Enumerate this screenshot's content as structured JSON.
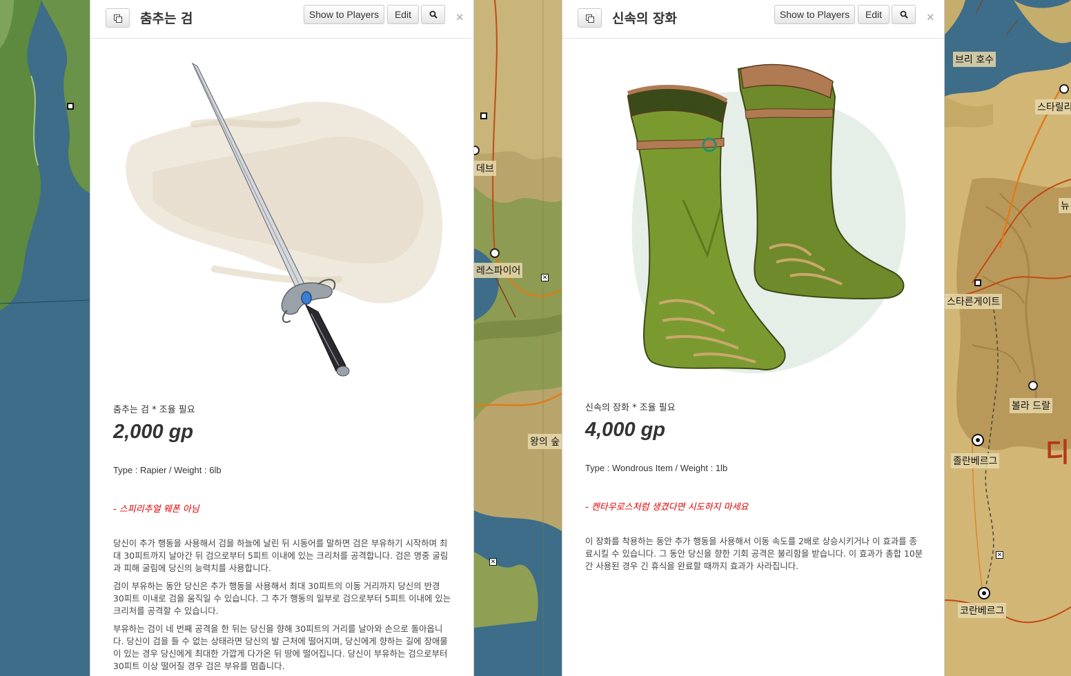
{
  "map": {
    "labels": {
      "dev": "데브",
      "lespire": "레스파이어",
      "king_forest": "왕의 숲",
      "bree_lake": "브리 호수",
      "starill": "스타릴리",
      "nyu": "뉴",
      "starngate": "스타른게이트",
      "bolla_dral": "볼라 드랄",
      "jolanberg": "졸란베르그",
      "koranberg": "코란베르그",
      "region": "디"
    }
  },
  "panels": [
    {
      "title": "춤추는 검",
      "buttons": {
        "show": "Show to Players",
        "edit": "Edit"
      },
      "subtitle": "춤추는 검 * 조율 필요",
      "price": "2,000 gp",
      "type_line": "Type : Rapier / Weight : 6lb",
      "note": "- 스피리추얼 웨폰 아님",
      "paragraphs": [
        "당신이 추가 행동을 사용해서 검을 하늘에 날린 뒤 시동어를 말하면 검은 부유하기 시작하며 최대 30피트까지 날아간 뒤 검으로부터 5피트 이내에 있는 크리처를 공격합니다. 검은 명중 굴림과 피해 굴림에 당신의 능력치를 사용합니다.",
        "검이 부유하는 동안 당신은 추가 행동을 사용해서 최대 30피트의 이동 거리까지 당신의 반경 30피트 이내로 검을 움직일 수 있습니다. 그 추가 행동의 일부로 검으로부터 5피트 이내에 있는 크리처를 공격할 수 있습니다.",
        "부유하는 검이 네 번째 공격을 한 뒤는 당신을 향해 30피트의 거리를 날아와 손으로 돌아옵니다. 당신이 검을 들 수 없는 상태라면 당신의 발 근처에 떨어지며, 당신에게 향하는 길에 장애물이 있는 경우 당신에게 최대한 가깝게 다가온 뒤 땅에 떨어집니다. 당신이 부유하는 검으로부터 30피트 이상 떨어질 경우 검은 부유를 멈춥니다."
      ]
    },
    {
      "title": "신속의 장화",
      "buttons": {
        "show": "Show to Players",
        "edit": "Edit"
      },
      "subtitle": "신속의 장화 * 조율 필요",
      "price": "4,000 gp",
      "type_line": "Type : Wondrous Item / Weight : 1lb",
      "note": "- 켄타우로스처럼 생겼다면 시도하지 마세요",
      "paragraphs": [
        "이 장화를 착용하는 동안 추가 행동을 사용해서 이동 속도를 2배로 상승시키거나 이 효과를 종료시킬 수 있습니다. 그 동안 당신을 향한 기회 공격은 불리함을 받습니다. 이 효과가 총합 10분간 사용된 경우 긴 휴식을 완료할 때까지 효과가 사라집니다."
      ]
    }
  ]
}
